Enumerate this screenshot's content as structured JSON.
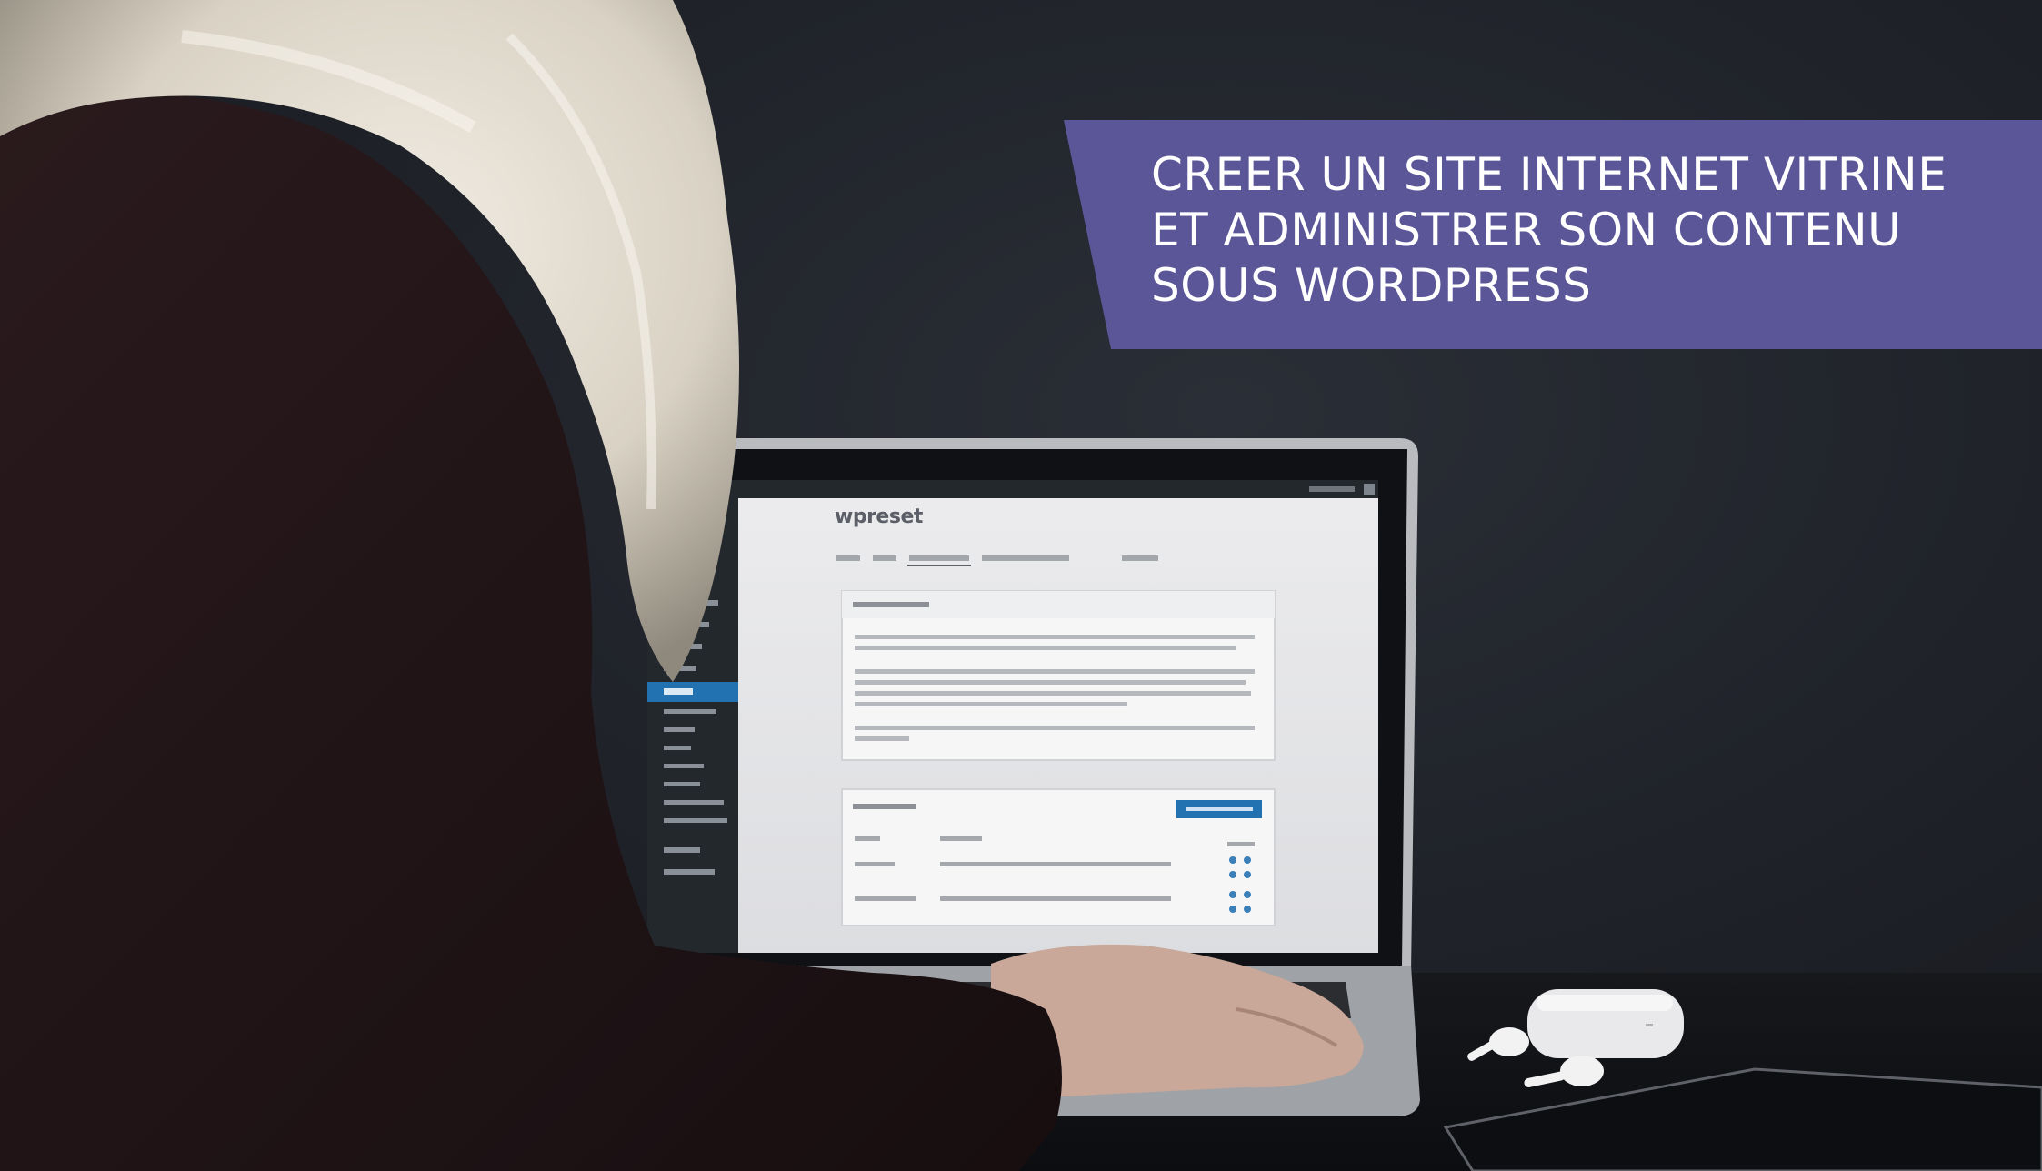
{
  "banner": {
    "title": "CREER UN SITE INTERNET VITRINE\nET ADMINISTRER SON CONTENU\nSOUS WORDPRESS"
  },
  "screen": {
    "logo_text": "wpreset"
  },
  "colors": {
    "banner_background": "#5b5698",
    "banner_text": "#ffffff",
    "wall": "#23262d",
    "screen": "#e6e7e9",
    "admin_sidebar": "#23282d",
    "accent_button": "#2271b1"
  }
}
